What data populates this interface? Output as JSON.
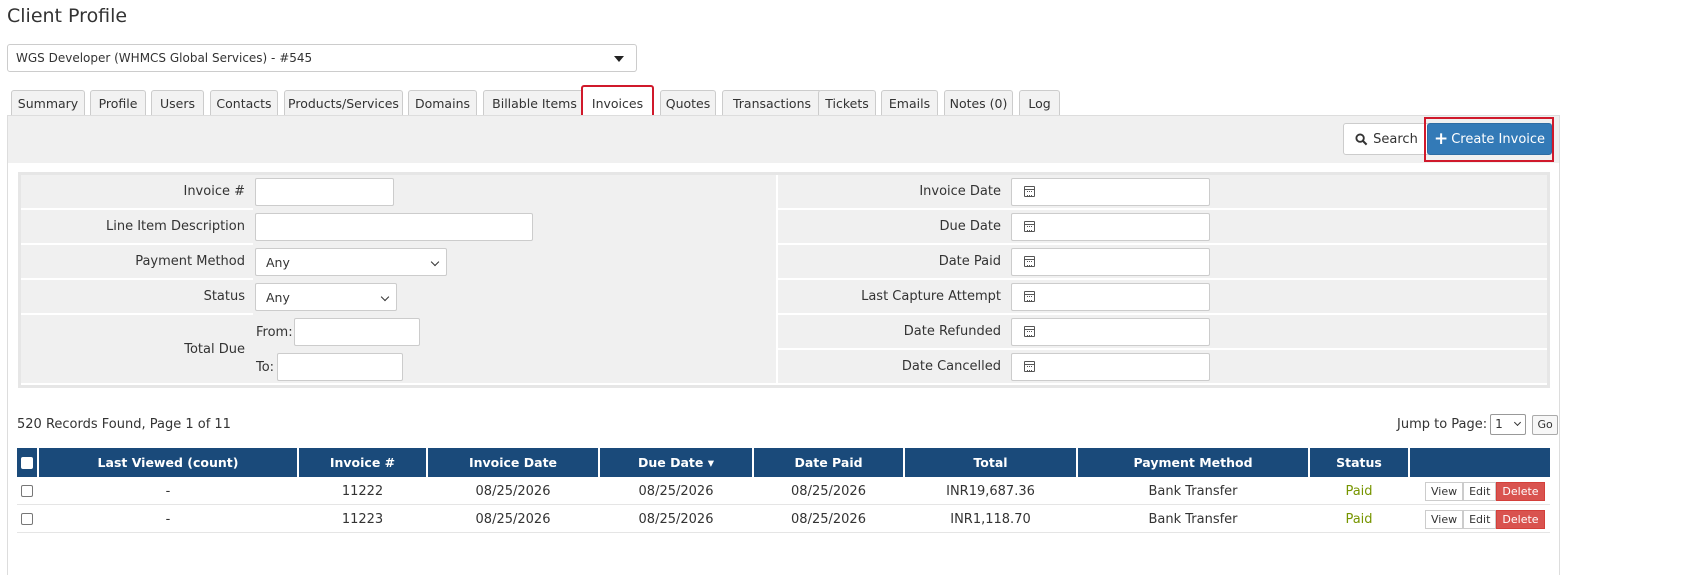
{
  "page": {
    "title": "Client Profile"
  },
  "client_select": {
    "value": "WGS Developer (WHMCS Global Services) - #545"
  },
  "tabs": [
    {
      "label": "Summary"
    },
    {
      "label": "Profile"
    },
    {
      "label": "Users"
    },
    {
      "label": "Contacts"
    },
    {
      "label": "Products/Services"
    },
    {
      "label": "Domains"
    },
    {
      "label": "Billable Items"
    },
    {
      "label": "Invoices"
    },
    {
      "label": "Quotes"
    },
    {
      "label": "Transactions"
    },
    {
      "label": "Tickets"
    },
    {
      "label": "Emails"
    },
    {
      "label": "Notes (0)"
    },
    {
      "label": "Log"
    }
  ],
  "active_tab": "Invoices",
  "toolbar": {
    "search_label": "Search",
    "create_label": "Create Invoice"
  },
  "filters": {
    "invoice_num": "Invoice #",
    "line_item": "Line Item Description",
    "payment_method": "Payment Method",
    "payment_method_value": "Any",
    "status": "Status",
    "status_value": "Any",
    "total_due": "Total Due",
    "from": "From:",
    "to": "To:",
    "invoice_date": "Invoice Date",
    "due_date": "Due Date",
    "date_paid": "Date Paid",
    "last_capture": "Last Capture Attempt",
    "date_refunded": "Date Refunded",
    "date_cancelled": "Date Cancelled"
  },
  "records": {
    "summary": "520 Records Found, Page 1 of 11",
    "jump_label": "Jump to Page:",
    "page_value": "1",
    "go_label": "Go"
  },
  "table": {
    "headers": [
      "Last Viewed (count)",
      "Invoice #",
      "Invoice Date",
      "Due Date ▾",
      "Date Paid",
      "Total",
      "Payment Method",
      "Status"
    ],
    "rows": [
      {
        "last_viewed": "-",
        "invoice": "11222",
        "invoice_date": "08/25/2026",
        "due_date": "08/25/2026",
        "date_paid": "08/25/2026",
        "total": "INR19,687.36",
        "method": "Bank Transfer",
        "status": "Paid"
      },
      {
        "last_viewed": "-",
        "invoice": "11223",
        "invoice_date": "08/25/2026",
        "due_date": "08/25/2026",
        "date_paid": "08/25/2026",
        "total": "INR1,118.70",
        "method": "Bank Transfer",
        "status": "Paid"
      }
    ],
    "actions": {
      "view": "View",
      "edit": "Edit",
      "delete": "Delete"
    }
  },
  "colors": {
    "header_bg": "#1a4a7a",
    "primary": "#337ab7",
    "highlight": "#d0192b",
    "paid": "#779500",
    "delete": "#d9534f"
  }
}
